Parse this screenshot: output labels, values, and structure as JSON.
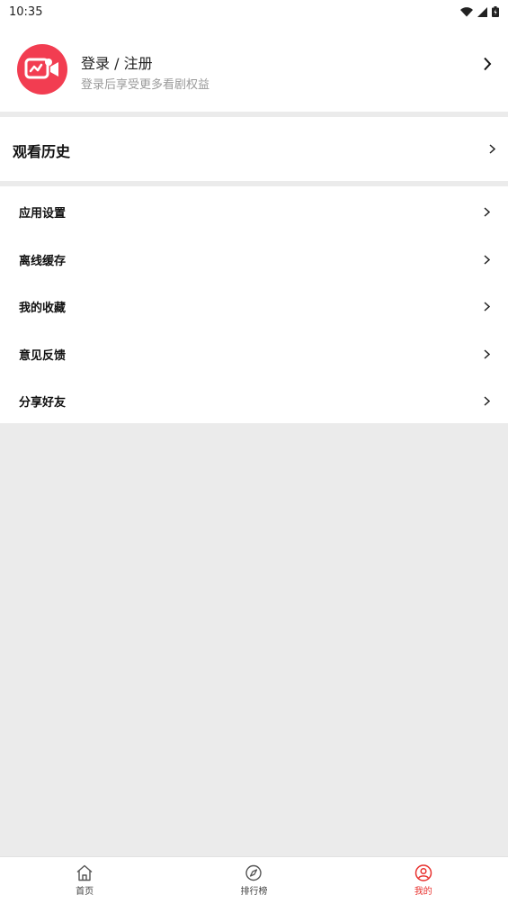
{
  "status_bar": {
    "time": "10:35"
  },
  "profile": {
    "title": "登录 / 注册",
    "subtitle": "登录后享受更多看剧权益",
    "accent": "#f23d51"
  },
  "history": {
    "title": "观看历史"
  },
  "menu": {
    "items": [
      {
        "label": "应用设置"
      },
      {
        "label": "离线缓存"
      },
      {
        "label": "我的收藏"
      },
      {
        "label": "意见反馈"
      },
      {
        "label": "分享好友"
      }
    ]
  },
  "tabbar": {
    "tabs": [
      {
        "label": "首页",
        "icon": "home-icon",
        "active": false
      },
      {
        "label": "排行榜",
        "icon": "compass-icon",
        "active": false
      },
      {
        "label": "我的",
        "icon": "user-icon",
        "active": true
      }
    ],
    "active_color": "#e8322f"
  }
}
